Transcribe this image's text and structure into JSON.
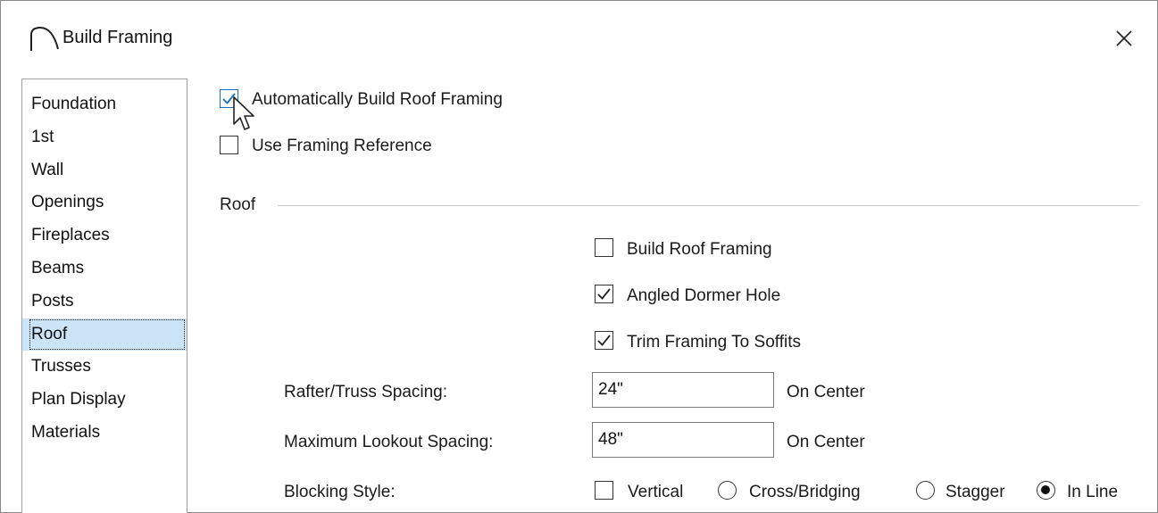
{
  "window": {
    "title": "Build Framing",
    "app_icon": "arc-icon",
    "close_glyph": "✕"
  },
  "nav": {
    "items": [
      {
        "label": "Foundation",
        "selected": false
      },
      {
        "label": "1st",
        "selected": false
      },
      {
        "label": "Wall",
        "selected": false
      },
      {
        "label": "Openings",
        "selected": false
      },
      {
        "label": "Fireplaces",
        "selected": false
      },
      {
        "label": "Beams",
        "selected": false
      },
      {
        "label": "Posts",
        "selected": false
      },
      {
        "label": "Roof",
        "selected": true
      },
      {
        "label": "Trusses",
        "selected": false
      },
      {
        "label": "Plan Display",
        "selected": false
      },
      {
        "label": "Materials",
        "selected": false
      }
    ]
  },
  "top_options": {
    "auto_build": {
      "label": "Automatically Build Roof Framing",
      "checked": true
    },
    "framing_reference": {
      "label": "Use Framing Reference",
      "checked": false
    }
  },
  "roof": {
    "section_label": "Roof",
    "build_roof_framing": {
      "label": "Build Roof Framing",
      "checked": false
    },
    "angled_dormer_hole": {
      "label": "Angled Dormer Hole",
      "checked": true
    },
    "trim_to_soffits": {
      "label": "Trim Framing To Soffits",
      "checked": true
    },
    "rafter_spacing": {
      "label": "Rafter/Truss Spacing:",
      "value": "24\"",
      "unit": "On Center"
    },
    "lookout_spacing": {
      "label": "Maximum Lookout Spacing:",
      "value": "48\"",
      "unit": "On Center"
    },
    "blocking": {
      "label": "Blocking Style:",
      "vertical": {
        "label": "Vertical",
        "checked": false
      },
      "options": [
        {
          "label": "Cross/Bridging",
          "selected": false
        },
        {
          "label": "Stagger",
          "selected": false
        },
        {
          "label": "In Line",
          "selected": true
        }
      ]
    }
  },
  "colors": {
    "selection": "#cce4f7",
    "focus_accent": "#1a6ec2"
  }
}
